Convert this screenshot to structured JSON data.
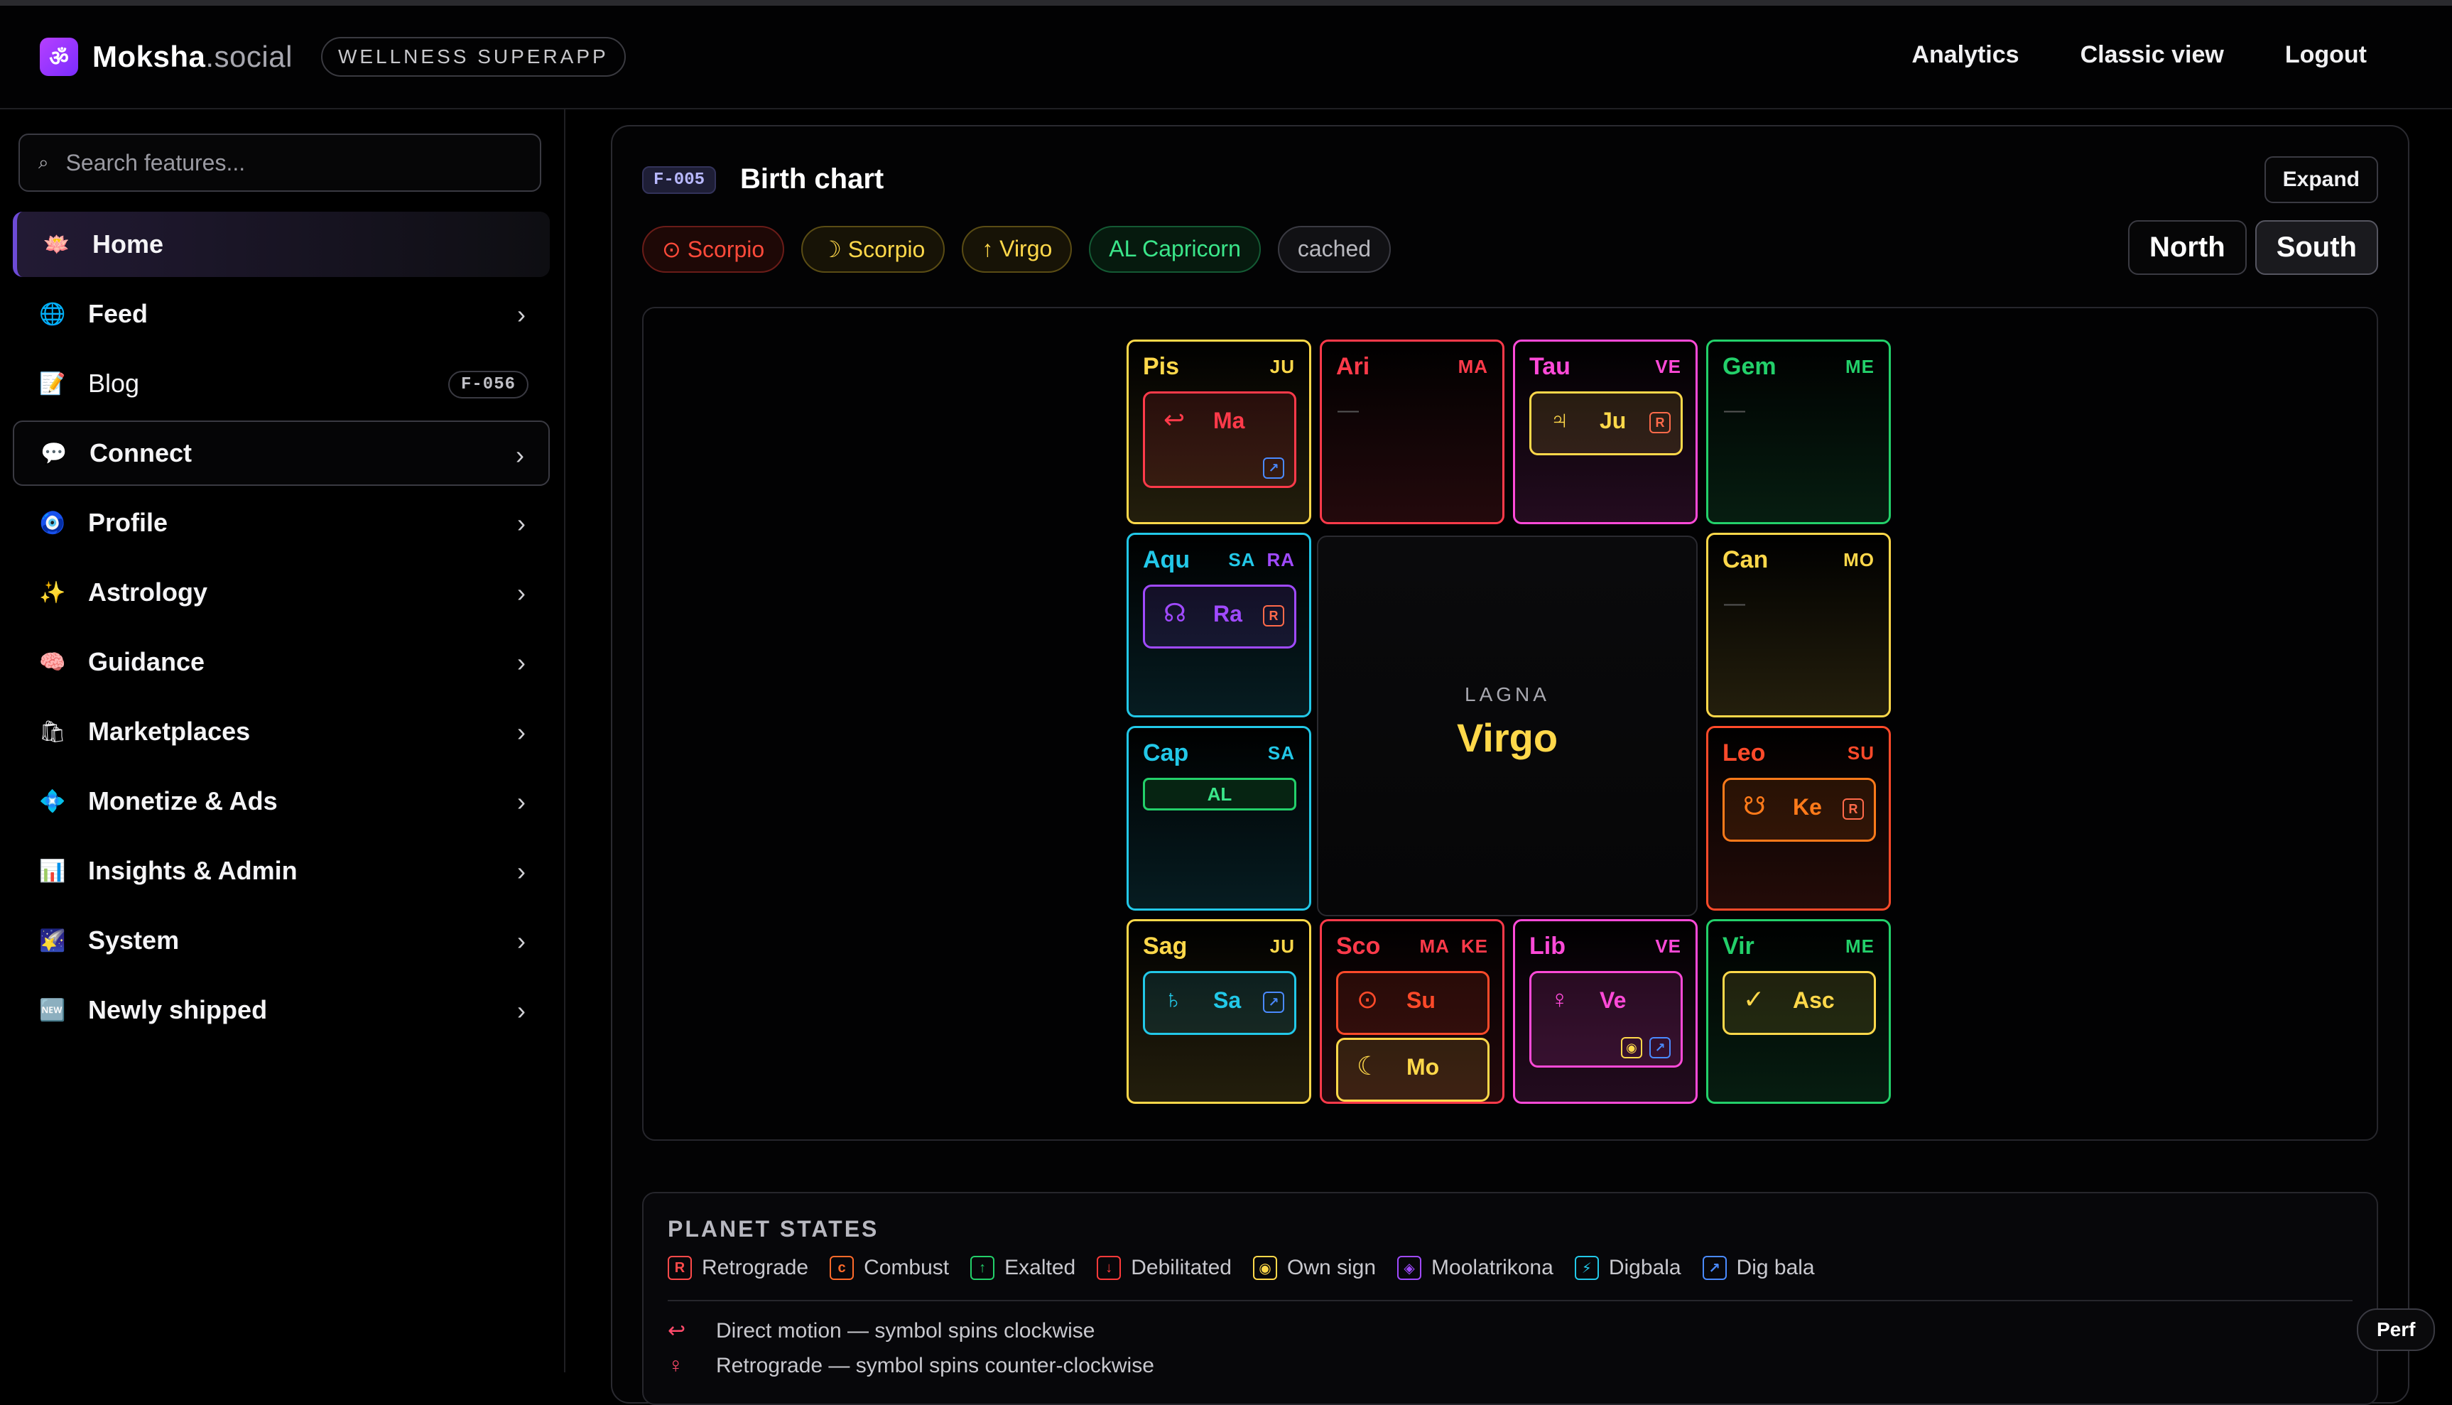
{
  "app": {
    "title": "Moksha.social",
    "title_main": "Moksha",
    "title_ext": ".social",
    "tagline": "WELLNESS SUPERAPP",
    "logo_icon": "om-icon"
  },
  "header": {
    "links": [
      "Analytics",
      "Classic view",
      "Logout"
    ]
  },
  "sidebar": {
    "search_placeholder": "Search features...",
    "items": [
      {
        "label": "Home",
        "icon": "lotus-icon",
        "glyph": "🪷",
        "chevron": false
      },
      {
        "label": "Feed",
        "icon": "globe-icon",
        "glyph": "🌐",
        "chevron": true
      },
      {
        "label": "Blog",
        "icon": "memo-icon",
        "glyph": "📝",
        "chevron": false,
        "badge": "F-056"
      },
      {
        "label": "Connect",
        "icon": "speech-bubble-icon",
        "glyph": "💬",
        "chevron": true
      },
      {
        "label": "Profile",
        "icon": "nazar-eye-icon",
        "glyph": "🧿",
        "chevron": true
      },
      {
        "label": "Astrology",
        "icon": "sparkles-icon",
        "glyph": "✨",
        "chevron": true
      },
      {
        "label": "Guidance",
        "icon": "brain-icon",
        "glyph": "🧠",
        "chevron": true
      },
      {
        "label": "Marketplaces",
        "icon": "shopping-bags-icon",
        "glyph": "🛍",
        "chevron": true
      },
      {
        "label": "Monetize & Ads",
        "icon": "diamond-icon",
        "glyph": "💠",
        "chevron": true
      },
      {
        "label": "Insights & Admin",
        "icon": "bar-chart-icon",
        "glyph": "📊",
        "chevron": true
      },
      {
        "label": "System",
        "icon": "night-sky-icon",
        "glyph": "🌠",
        "chevron": true
      },
      {
        "label": "Newly shipped",
        "icon": "new-badge-icon",
        "glyph": "🆕",
        "chevron": true
      }
    ]
  },
  "panel": {
    "id": "F-005",
    "title": "Birth chart",
    "expand_label": "Expand",
    "pills": [
      {
        "text": "⊙ Scorpio",
        "kind": "sun"
      },
      {
        "text": "☽ Scorpio",
        "kind": "moon"
      },
      {
        "text": "↑ Virgo",
        "kind": "asc"
      },
      {
        "text": "AL Capricorn",
        "kind": "al"
      },
      {
        "text": "cached",
        "kind": "cached"
      }
    ],
    "style_options": [
      "North",
      "South"
    ],
    "lagna_label": "LAGNA",
    "lagna_value": "Virgo"
  },
  "colors": {
    "yellow": "#ffd84a",
    "red": "#ff3a4a",
    "magenta": "#ff4ad8",
    "green": "#23d06a",
    "cyan": "#22c8e8",
    "orange": "#ff7a1a",
    "purple": "#a04aff"
  },
  "houses": [
    {
      "sign": "Pis",
      "lords": [
        "JU"
      ],
      "color": "#ffd84a",
      "grid": [
        0,
        0
      ],
      "planets": [
        {
          "name": "Ma",
          "glyph": "↩",
          "color": "#ff3a4a",
          "badges": [
            "↗"
          ]
        }
      ]
    },
    {
      "sign": "Ari",
      "lords": [
        "MA"
      ],
      "color": "#ff3a4a",
      "grid": [
        1,
        0
      ],
      "empty": "—",
      "planets": []
    },
    {
      "sign": "Tau",
      "lords": [
        "VE"
      ],
      "color": "#ff4ad8",
      "grid": [
        2,
        0
      ],
      "planets": [
        {
          "name": "Ju",
          "glyph": "♃",
          "color": "#ffd84a",
          "badges": [
            "R"
          ]
        }
      ]
    },
    {
      "sign": "Gem",
      "lords": [
        "ME"
      ],
      "color": "#23d06a",
      "grid": [
        3,
        0
      ],
      "empty": "—",
      "planets": []
    },
    {
      "sign": "Aqu",
      "lords": [
        "SA",
        "RA"
      ],
      "color": "#22c8e8",
      "grid": [
        0,
        1
      ],
      "planets": [
        {
          "name": "Ra",
          "glyph": "☊",
          "color": "#a04aff",
          "badges": [
            "R"
          ]
        }
      ]
    },
    {
      "sign": "Can",
      "lords": [
        "MO"
      ],
      "color": "#ffd84a",
      "grid": [
        3,
        1
      ],
      "empty": "—",
      "planets": []
    },
    {
      "sign": "Cap",
      "lords": [
        "SA"
      ],
      "color": "#22c8e8",
      "grid": [
        0,
        2
      ],
      "al": "AL",
      "planets": []
    },
    {
      "sign": "Leo",
      "lords": [
        "SU"
      ],
      "color": "#ff4a2a",
      "grid": [
        3,
        2
      ],
      "planets": [
        {
          "name": "Ke",
          "glyph": "☋",
          "color": "#ff7a1a",
          "badges": [
            "R"
          ]
        }
      ]
    },
    {
      "sign": "Sag",
      "lords": [
        "JU"
      ],
      "color": "#ffd84a",
      "grid": [
        0,
        3
      ],
      "planets": [
        {
          "name": "Sa",
          "glyph": "♄",
          "color": "#22c8e8",
          "badges": [
            "↗"
          ]
        }
      ]
    },
    {
      "sign": "Sco",
      "lords": [
        "MA",
        "KE"
      ],
      "color": "#ff3a4a",
      "grid": [
        1,
        3
      ],
      "planets": [
        {
          "name": "Su",
          "glyph": "⊙",
          "color": "#ff4a2a",
          "badges": []
        },
        {
          "name": "Mo",
          "glyph": "☾",
          "color": "#ffd84a",
          "badges": []
        }
      ]
    },
    {
      "sign": "Lib",
      "lords": [
        "VE"
      ],
      "color": "#ff4ad8",
      "grid": [
        2,
        3
      ],
      "planets": [
        {
          "name": "Ve",
          "glyph": "♀",
          "color": "#ff4ad8",
          "badges": [
            "◉",
            "↗"
          ]
        }
      ]
    },
    {
      "sign": "Vir",
      "lords": [
        "ME"
      ],
      "color": "#23d06a",
      "grid": [
        3,
        3
      ],
      "planets": [
        {
          "name": "Asc",
          "glyph": "✓",
          "color": "#ffd84a",
          "badges": []
        }
      ]
    }
  ],
  "legend": {
    "title": "PLANET STATES",
    "items": [
      {
        "sym": "R",
        "label": "Retrograde",
        "color": "#ff4a4a"
      },
      {
        "sym": "c",
        "label": "Combust",
        "color": "#ff6a2a"
      },
      {
        "sym": "↑",
        "label": "Exalted",
        "color": "#23d06a"
      },
      {
        "sym": "↓",
        "label": "Debilitated",
        "color": "#ff3a3a"
      },
      {
        "sym": "◉",
        "label": "Own sign",
        "color": "#ffd84a"
      },
      {
        "sym": "◈",
        "label": "Moolatrikona",
        "color": "#a04aff"
      },
      {
        "sym": "⚡",
        "label": "Digbala",
        "color": "#22c8e8"
      },
      {
        "sym": "↗",
        "label": "Dig bala",
        "color": "#4a8aff"
      }
    ],
    "motions": [
      {
        "glyph": "↩",
        "text": "Direct motion — symbol spins clockwise"
      },
      {
        "glyph": "♀",
        "text": "Retrograde — symbol spins counter-clockwise"
      }
    ]
  },
  "perf_label": "Perf"
}
